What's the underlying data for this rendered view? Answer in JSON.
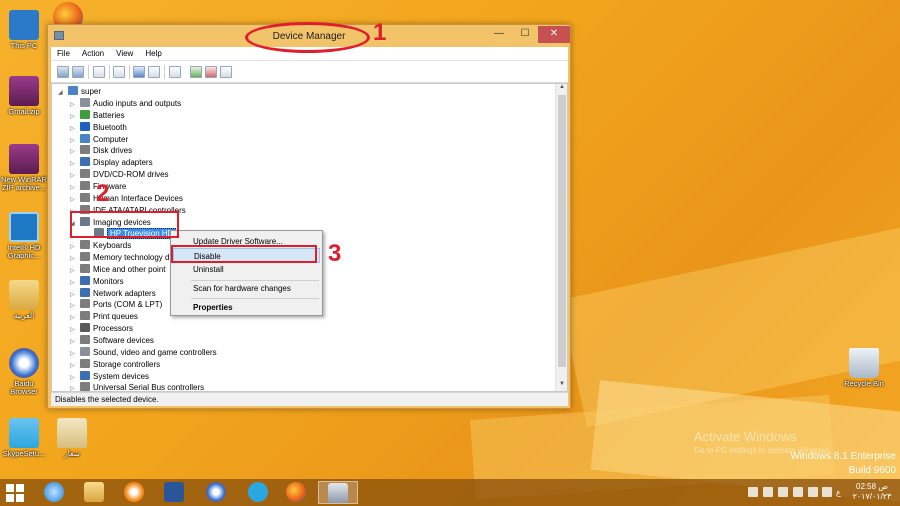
{
  "desktop": {
    "icons": [
      {
        "label": "This PC",
        "color": "#2b79c9"
      },
      {
        "label": "Gmail.zip",
        "color": "#7a2c6b"
      },
      {
        "label": "New WinRAR ZIP archive...",
        "color": "#7a2c6b"
      },
      {
        "label": "Intel® HD Graphic...",
        "color": "#1d79c4"
      },
      {
        "label": "العربية",
        "color": "#e0b24a"
      },
      {
        "label": "Baidu Browser",
        "color": "#2f6fd0"
      },
      {
        "label": "SkypeSetu...",
        "color": "#2aa7e0"
      },
      {
        "label": "شعار",
        "color": "#e8d6a0"
      },
      {
        "label": "Recycle Bin",
        "color": "#c7d3df"
      }
    ]
  },
  "window": {
    "title": "Device Manager",
    "min_label": "—",
    "max_label": "☐",
    "close_label": "✕",
    "menu": [
      "File",
      "Action",
      "View",
      "Help"
    ],
    "status": "Disables the selected device."
  },
  "tree": {
    "root": "super",
    "items": [
      {
        "label": "Audio inputs and outputs",
        "icon_color": "#8a8f9a"
      },
      {
        "label": "Batteries",
        "icon_color": "#3f9e3c"
      },
      {
        "label": "Bluetooth",
        "icon_color": "#1f5fbf"
      },
      {
        "label": "Computer",
        "icon_color": "#4a84c5"
      },
      {
        "label": "Disk drives",
        "icon_color": "#7d7d7d"
      },
      {
        "label": "Display adapters",
        "icon_color": "#3b6fb0"
      },
      {
        "label": "DVD/CD-ROM drives",
        "icon_color": "#7d7d7d"
      },
      {
        "label": "Firmware",
        "icon_color": "#7d7d7d"
      },
      {
        "label": "Human Interface Devices",
        "icon_color": "#7d7d7d"
      },
      {
        "label": "IDE ATA/ATAPI controllers",
        "icon_color": "#7d7d7d"
      },
      {
        "label": "Imaging devices",
        "icon_color": "#6a7a8a"
      },
      {
        "label": "HP Truevision HD",
        "icon_color": "#6a7a8a"
      },
      {
        "label": "Keyboards",
        "icon_color": "#7d7d7d"
      },
      {
        "label": "Memory technology d",
        "icon_color": "#7d7d7d"
      },
      {
        "label": "Mice and other point",
        "icon_color": "#7d7d7d"
      },
      {
        "label": "Monitors",
        "icon_color": "#3b6fb0"
      },
      {
        "label": "Network adapters",
        "icon_color": "#3b6fb0"
      },
      {
        "label": "Ports (COM & LPT)",
        "icon_color": "#7d7d7d"
      },
      {
        "label": "Print queues",
        "icon_color": "#7d7d7d"
      },
      {
        "label": "Processors",
        "icon_color": "#5a5a5a"
      },
      {
        "label": "Software devices",
        "icon_color": "#7d7d7d"
      },
      {
        "label": "Sound, video and game controllers",
        "icon_color": "#8a8f9a"
      },
      {
        "label": "Storage controllers",
        "icon_color": "#7d7d7d"
      },
      {
        "label": "System devices",
        "icon_color": "#3b6fb0"
      },
      {
        "label": "Universal Serial Bus controllers",
        "icon_color": "#7d7d7d"
      }
    ]
  },
  "context_menu": {
    "items": [
      "Update Driver Software...",
      "Disable",
      "Uninstall",
      "Scan for hardware changes",
      "Properties"
    ]
  },
  "annotations": {
    "one": "1",
    "two": "2",
    "three": "3",
    "color": "#e01d2c"
  },
  "watermark": {
    "title": "Activate Windows",
    "subtitle": "Go to PC settings to activate Windows.",
    "edition": "Windows 8.1 Enterprise",
    "build": "Build 9600"
  },
  "taskbar": {
    "clock_time": "ص 02:58",
    "clock_date": "٢٠١٧/٠١/٢٣",
    "lang": "ع"
  }
}
